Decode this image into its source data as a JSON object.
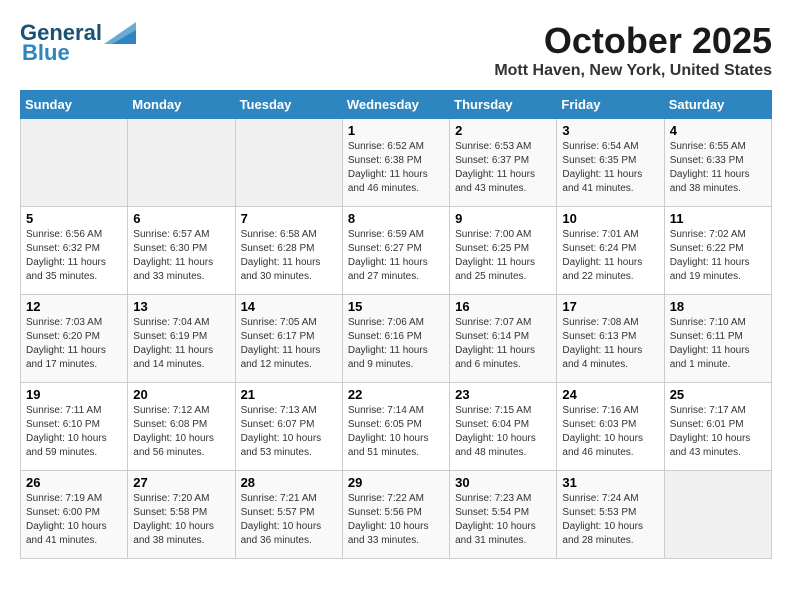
{
  "header": {
    "logo_general": "General",
    "logo_blue": "Blue",
    "month": "October 2025",
    "location": "Mott Haven, New York, United States"
  },
  "weekdays": [
    "Sunday",
    "Monday",
    "Tuesday",
    "Wednesday",
    "Thursday",
    "Friday",
    "Saturday"
  ],
  "weeks": [
    [
      {
        "day": null,
        "sunrise": null,
        "sunset": null,
        "daylight": null
      },
      {
        "day": null,
        "sunrise": null,
        "sunset": null,
        "daylight": null
      },
      {
        "day": null,
        "sunrise": null,
        "sunset": null,
        "daylight": null
      },
      {
        "day": "1",
        "sunrise": "6:52 AM",
        "sunset": "6:38 PM",
        "daylight": "11 hours and 46 minutes."
      },
      {
        "day": "2",
        "sunrise": "6:53 AM",
        "sunset": "6:37 PM",
        "daylight": "11 hours and 43 minutes."
      },
      {
        "day": "3",
        "sunrise": "6:54 AM",
        "sunset": "6:35 PM",
        "daylight": "11 hours and 41 minutes."
      },
      {
        "day": "4",
        "sunrise": "6:55 AM",
        "sunset": "6:33 PM",
        "daylight": "11 hours and 38 minutes."
      }
    ],
    [
      {
        "day": "5",
        "sunrise": "6:56 AM",
        "sunset": "6:32 PM",
        "daylight": "11 hours and 35 minutes."
      },
      {
        "day": "6",
        "sunrise": "6:57 AM",
        "sunset": "6:30 PM",
        "daylight": "11 hours and 33 minutes."
      },
      {
        "day": "7",
        "sunrise": "6:58 AM",
        "sunset": "6:28 PM",
        "daylight": "11 hours and 30 minutes."
      },
      {
        "day": "8",
        "sunrise": "6:59 AM",
        "sunset": "6:27 PM",
        "daylight": "11 hours and 27 minutes."
      },
      {
        "day": "9",
        "sunrise": "7:00 AM",
        "sunset": "6:25 PM",
        "daylight": "11 hours and 25 minutes."
      },
      {
        "day": "10",
        "sunrise": "7:01 AM",
        "sunset": "6:24 PM",
        "daylight": "11 hours and 22 minutes."
      },
      {
        "day": "11",
        "sunrise": "7:02 AM",
        "sunset": "6:22 PM",
        "daylight": "11 hours and 19 minutes."
      }
    ],
    [
      {
        "day": "12",
        "sunrise": "7:03 AM",
        "sunset": "6:20 PM",
        "daylight": "11 hours and 17 minutes."
      },
      {
        "day": "13",
        "sunrise": "7:04 AM",
        "sunset": "6:19 PM",
        "daylight": "11 hours and 14 minutes."
      },
      {
        "day": "14",
        "sunrise": "7:05 AM",
        "sunset": "6:17 PM",
        "daylight": "11 hours and 12 minutes."
      },
      {
        "day": "15",
        "sunrise": "7:06 AM",
        "sunset": "6:16 PM",
        "daylight": "11 hours and 9 minutes."
      },
      {
        "day": "16",
        "sunrise": "7:07 AM",
        "sunset": "6:14 PM",
        "daylight": "11 hours and 6 minutes."
      },
      {
        "day": "17",
        "sunrise": "7:08 AM",
        "sunset": "6:13 PM",
        "daylight": "11 hours and 4 minutes."
      },
      {
        "day": "18",
        "sunrise": "7:10 AM",
        "sunset": "6:11 PM",
        "daylight": "11 hours and 1 minute."
      }
    ],
    [
      {
        "day": "19",
        "sunrise": "7:11 AM",
        "sunset": "6:10 PM",
        "daylight": "10 hours and 59 minutes."
      },
      {
        "day": "20",
        "sunrise": "7:12 AM",
        "sunset": "6:08 PM",
        "daylight": "10 hours and 56 minutes."
      },
      {
        "day": "21",
        "sunrise": "7:13 AM",
        "sunset": "6:07 PM",
        "daylight": "10 hours and 53 minutes."
      },
      {
        "day": "22",
        "sunrise": "7:14 AM",
        "sunset": "6:05 PM",
        "daylight": "10 hours and 51 minutes."
      },
      {
        "day": "23",
        "sunrise": "7:15 AM",
        "sunset": "6:04 PM",
        "daylight": "10 hours and 48 minutes."
      },
      {
        "day": "24",
        "sunrise": "7:16 AM",
        "sunset": "6:03 PM",
        "daylight": "10 hours and 46 minutes."
      },
      {
        "day": "25",
        "sunrise": "7:17 AM",
        "sunset": "6:01 PM",
        "daylight": "10 hours and 43 minutes."
      }
    ],
    [
      {
        "day": "26",
        "sunrise": "7:19 AM",
        "sunset": "6:00 PM",
        "daylight": "10 hours and 41 minutes."
      },
      {
        "day": "27",
        "sunrise": "7:20 AM",
        "sunset": "5:58 PM",
        "daylight": "10 hours and 38 minutes."
      },
      {
        "day": "28",
        "sunrise": "7:21 AM",
        "sunset": "5:57 PM",
        "daylight": "10 hours and 36 minutes."
      },
      {
        "day": "29",
        "sunrise": "7:22 AM",
        "sunset": "5:56 PM",
        "daylight": "10 hours and 33 minutes."
      },
      {
        "day": "30",
        "sunrise": "7:23 AM",
        "sunset": "5:54 PM",
        "daylight": "10 hours and 31 minutes."
      },
      {
        "day": "31",
        "sunrise": "7:24 AM",
        "sunset": "5:53 PM",
        "daylight": "10 hours and 28 minutes."
      },
      {
        "day": null,
        "sunrise": null,
        "sunset": null,
        "daylight": null
      }
    ]
  ]
}
